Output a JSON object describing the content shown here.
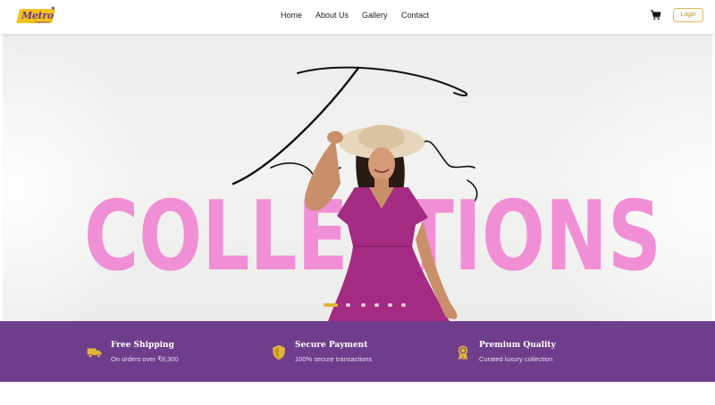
{
  "brand": {
    "logo_text": "Metro",
    "logo_sub": "Fashions",
    "colors": {
      "primary": "#6e3e8c",
      "accent": "#f4c21c",
      "headline": "#f08fd6"
    }
  },
  "nav": {
    "items": [
      {
        "label": "Home"
      },
      {
        "label": "About Us"
      },
      {
        "label": "Gallery"
      },
      {
        "label": "Contact"
      }
    ],
    "cart_icon": "shopping-cart-icon",
    "login_label": "Login"
  },
  "hero": {
    "headline": "COLLECTIONS",
    "script_word": "Trending",
    "slide_count": 6,
    "active_slide": 1
  },
  "features": [
    {
      "icon": "truck-icon",
      "title": "Free Shipping",
      "subtitle": "On orders over ₹8,300"
    },
    {
      "icon": "shield-icon",
      "title": "Secure Payment",
      "subtitle": "100% secure transactions"
    },
    {
      "icon": "award-medal-icon",
      "title": "Premium Quality",
      "subtitle": "Curated luxury collection"
    }
  ]
}
